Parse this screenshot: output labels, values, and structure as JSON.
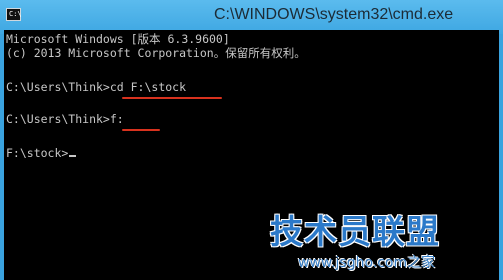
{
  "window": {
    "title": "C:\\WINDOWS\\system32\\cmd.exe",
    "icon_name": "console-icon",
    "icon_text": "C:\\"
  },
  "console": {
    "lines": [
      "Microsoft Windows [版本 6.3.9600]",
      "(c) 2013 Microsoft Corporation。保留所有权利。",
      "C:\\Users\\Think>cd F:\\stock",
      "C:\\Users\\Think>f:",
      "F:\\stock>"
    ],
    "text_color": "#c7c7c7",
    "background": "#000000",
    "highlight_color": "#d8321e"
  },
  "watermark": {
    "main": "技术员联盟",
    "sub": "www.jsgho.com之家"
  }
}
